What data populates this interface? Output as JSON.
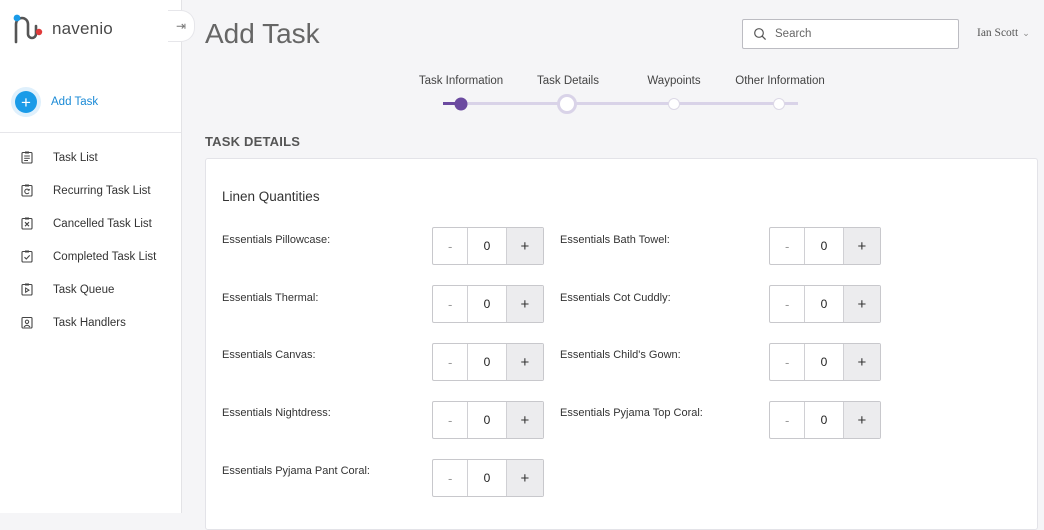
{
  "brand": {
    "name": "navenio"
  },
  "sidebar": {
    "add_task_label": "Add Task",
    "items": [
      {
        "label": "Task List",
        "icon": "task-list-icon"
      },
      {
        "label": "Recurring Task List",
        "icon": "recurring-task-icon"
      },
      {
        "label": "Cancelled Task List",
        "icon": "cancelled-task-icon"
      },
      {
        "label": "Completed Task List",
        "icon": "completed-task-icon"
      },
      {
        "label": "Task Queue",
        "icon": "task-queue-icon"
      },
      {
        "label": "Task Handlers",
        "icon": "task-handlers-icon"
      }
    ]
  },
  "header": {
    "title": "Add Task",
    "search_placeholder": "Search",
    "user_name": "Ian Scott"
  },
  "stepper": {
    "steps": [
      {
        "label": "Task Information",
        "state": "done"
      },
      {
        "label": "Task Details",
        "state": "current"
      },
      {
        "label": "Waypoints",
        "state": "upcoming"
      },
      {
        "label": "Other Information",
        "state": "upcoming"
      }
    ]
  },
  "section": {
    "title": "TASK DETAILS",
    "card_title": "Linen Quantities",
    "fields": [
      {
        "label": "Essentials Pillowcase:",
        "value": "0"
      },
      {
        "label": "Essentials Bath Towel:",
        "value": "0"
      },
      {
        "label": "Essentials Thermal:",
        "value": "0"
      },
      {
        "label": "Essentials Cot Cuddly:",
        "value": "0"
      },
      {
        "label": "Essentials Canvas:",
        "value": "0"
      },
      {
        "label": "Essentials Child's Gown:",
        "value": "0"
      },
      {
        "label": "Essentials Nightdress:",
        "value": "0"
      },
      {
        "label": "Essentials Pyjama Top Coral:",
        "value": "0"
      },
      {
        "label": "Essentials Pyjama Pant Coral:",
        "value": "0"
      }
    ],
    "minus_symbol": "-",
    "plus_symbol": "+"
  },
  "colors": {
    "accent": "#1a9be8",
    "step_active": "#6b4aa0",
    "step_track": "#d9d3e8"
  }
}
